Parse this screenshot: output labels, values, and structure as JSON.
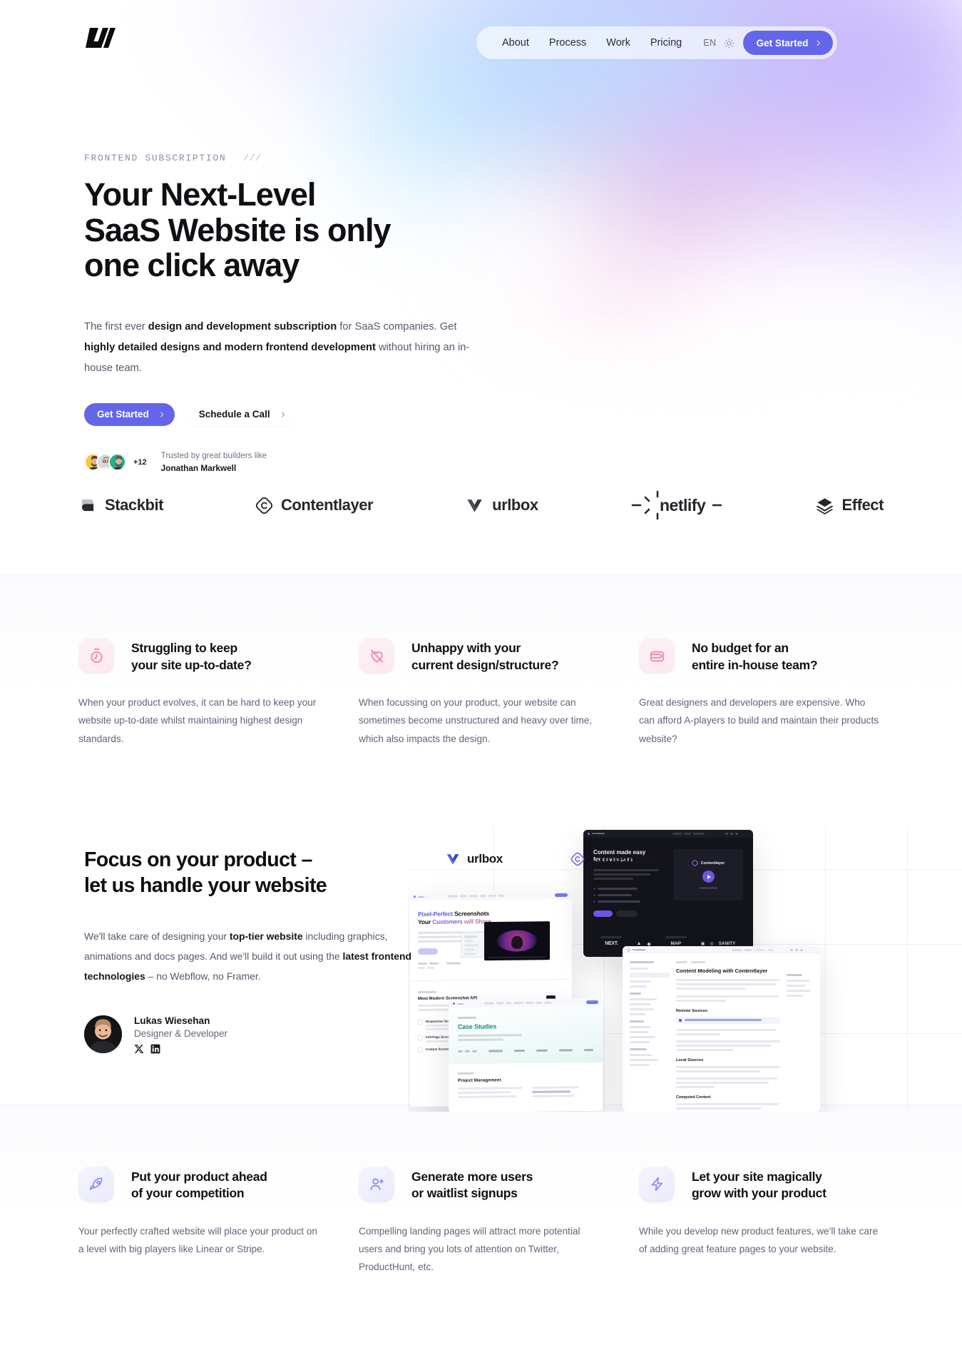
{
  "brand": {
    "name": "LW",
    "logo_icon": "lw-monogram-logo"
  },
  "colors": {
    "accent": "#6366e8",
    "rose_icon_bg": "#fdf2f5",
    "indigo_icon_bg": "#f4f4fd",
    "heading": "#101014",
    "body_text": "#55596b"
  },
  "nav": {
    "links": [
      {
        "label": "About"
      },
      {
        "label": "Process"
      },
      {
        "label": "Work"
      },
      {
        "label": "Pricing"
      }
    ],
    "language": "EN",
    "theme_icon": "sun-icon",
    "cta": {
      "label": "Get Started",
      "icon": "chevron-right-icon"
    }
  },
  "hero": {
    "eyebrow": "FRONTEND SUBSCRIPTION",
    "eyebrow_slashes": "///",
    "title_lines": [
      "Your Next-Level",
      "SaaS Website is only",
      "one click away"
    ],
    "body": {
      "p1_a": "The first ever ",
      "p1_b": "design and development subscription",
      "p1_c": " for SaaS companies. Get ",
      "p1_d": "highly detailed designs and modern frontend development",
      "p1_e": " without hiring an in-house team."
    },
    "cta_primary": {
      "label": "Get Started",
      "icon": "chevron-right-icon"
    },
    "cta_secondary": {
      "label": "Schedule a Call",
      "icon": "chevron-right-icon"
    },
    "social_proof": {
      "extra_count": "+12",
      "line1": "Trusted by great builders like",
      "line2": "Jonathan Markwell"
    }
  },
  "logo_strip": [
    {
      "name": "Stackbit",
      "icon": "stackbit-logo"
    },
    {
      "name": "Contentlayer",
      "icon": "contentlayer-logo"
    },
    {
      "name": "urlbox",
      "icon": "urlbox-logo"
    },
    {
      "name": "netlify",
      "icon": "netlify-logo"
    },
    {
      "name": "Effect",
      "icon": "effect-logo"
    }
  ],
  "problems": [
    {
      "icon": "timer-icon",
      "title_l1": "Struggling to keep",
      "title_l2": "your site up-to-date?",
      "body": "When your product evolves, it can be hard to keep your website up-to-date whilst maintaining highest design standards."
    },
    {
      "icon": "heart-off-icon",
      "title_l1": "Unhappy with your",
      "title_l2": "current design/structure?",
      "body": "When focussing on your product, your website can sometimes become unstructured and heavy over time, which also impacts the design."
    },
    {
      "icon": "wallet-icon",
      "title_l1": "No budget for an",
      "title_l2": "entire in-house team?",
      "body": "Great designers and developers are expensive. Who can afford A-players to build and maintain their products website?"
    }
  ],
  "showcase": {
    "title_l1": "Focus on your product –",
    "title_l2": "let us handle your website",
    "body": {
      "a": "We'll take care of designing your ",
      "b": "top-tier website",
      "c": " including graphics, animations and docs pages. And we'll build it out using the ",
      "d": "latest frontend technologies",
      "e": " – no Webflow, no Framer."
    },
    "person": {
      "name": "Lukas Wiesehan",
      "role": "Designer & Developer",
      "avatar": "portrait-avatar",
      "socials": [
        {
          "name": "x-twitter-icon"
        },
        {
          "name": "linkedin-icon"
        }
      ]
    },
    "brands": [
      {
        "name": "urlbox",
        "icon": "urlbox-logo"
      },
      {
        "name": "Contentlayer",
        "icon": "contentlayer-logo"
      }
    ],
    "mockups": [
      {
        "label": "Pixel-Perfect Screenshots Your Customers will Share",
        "sub": "Most Modern Screenshot API"
      },
      {
        "label": "Content made easy for developers",
        "sub": "Contentlayer"
      },
      {
        "label": "Content Modeling with Contentlayer",
        "sub": "Remote Sources"
      },
      {
        "label": "Case Studies",
        "sub": "Project Management"
      }
    ]
  },
  "benefits": [
    {
      "icon": "rocket-icon",
      "title_l1": "Put your product ahead",
      "title_l2": "of your competition",
      "body": "Your perfectly crafted website will place your product on a level with big players like Linear or Stripe."
    },
    {
      "icon": "user-plus-icon",
      "title_l1": "Generate more users",
      "title_l2": "or waitlist signups",
      "body": "Compelling landing pages will attract more potential users and bring you lots of attention on Twitter, ProductHunt, etc."
    },
    {
      "icon": "lightning-bolt-icon",
      "title_l1": "Let your site magically",
      "title_l2": "grow with your product",
      "body": "While you develop new product features, we'll take care of adding great feature pages to your website."
    }
  ]
}
